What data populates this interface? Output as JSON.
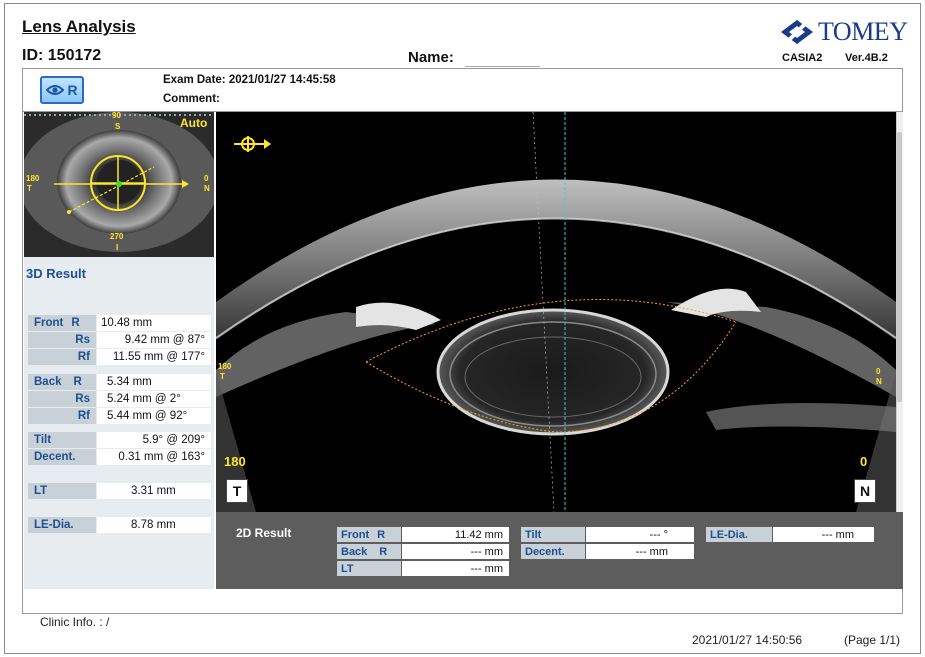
{
  "header": {
    "title": "Lens Analysis",
    "id": "ID: 150172",
    "name_label": "Name:",
    "brand": "TOMEY",
    "model": "CASIA2",
    "version": "Ver.4B.2",
    "eye": "R",
    "exam_date": "Exam Date: 2021/01/27 14:45:58",
    "comment": "Comment:"
  },
  "thumbnail": {
    "mode": "Auto",
    "angle_top": "90",
    "angle_top_side": "S",
    "angle_left": "180",
    "angle_left_side": "T",
    "angle_right": "0",
    "angle_right_side": "N",
    "angle_bottom": "270",
    "angle_bottom_side": "I"
  },
  "result3d": {
    "heading": "3D Result",
    "front_label": "Front",
    "front": [
      {
        "sub": "R",
        "value": "10.48 mm"
      },
      {
        "sub": "Rs",
        "value": "9.42 mm  @ 87°"
      },
      {
        "sub": "Rf",
        "value": "11.55 mm  @ 177°"
      }
    ],
    "back_label": "Back",
    "back": [
      {
        "sub": "R",
        "value": "5.34 mm"
      },
      {
        "sub": "Rs",
        "value": "5.24 mm  @ 2°"
      },
      {
        "sub": "Rf",
        "value": "5.44 mm  @ 92°"
      }
    ],
    "tilt_label": "Tilt",
    "tilt_value": "5.9°  @ 209°",
    "decent_label": "Decent.",
    "decent_value": "0.31 mm  @ 163°",
    "lt_label": "LT",
    "lt_value": "3.31  mm",
    "ledia_label": "LE-Dia.",
    "ledia_value": "8.78  mm"
  },
  "oct": {
    "left_degree": "180",
    "right_degree": "0",
    "left_side_small": "180",
    "left_side_small2": "T",
    "right_side_small": "0",
    "right_side_small2": "N",
    "left_button": "T",
    "right_button": "N"
  },
  "result2d": {
    "heading": "2D Result",
    "front_label": "Front",
    "front_sub": "R",
    "front_value": "11.42 mm",
    "back_label": "Back",
    "back_sub": "R",
    "back_value": "--- mm",
    "lt_label": "LT",
    "lt_value": "--- mm",
    "tilt_label": "Tilt",
    "tilt_value": "--- °",
    "decent_label": "Decent.",
    "decent_value": "--- mm",
    "ledia_label": "LE-Dia.",
    "ledia_value": "--- mm"
  },
  "footer": {
    "clinic": "Clinic Info. :   /",
    "printed": "2021/01/27 14:50:56",
    "page": "(Page 1/1)"
  },
  "colors": {
    "label_blue": "#1e4f8f",
    "label_bg": "#c8d0d8",
    "panel_bg": "#e7ecf1",
    "annotation_yellow": "#ffe52a",
    "brand_blue": "#1a3a8a"
  }
}
